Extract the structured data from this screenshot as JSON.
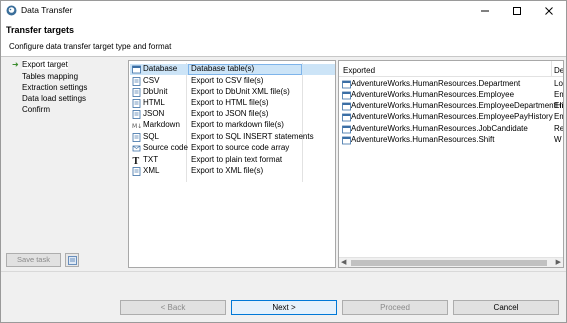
{
  "window": {
    "title": "Data Transfer",
    "controls": {
      "minimize": "minimize-icon",
      "maximize": "maximize-icon",
      "close": "close-icon"
    }
  },
  "header": {
    "title": "Transfer targets",
    "subtitle": "Configure data transfer target type and format"
  },
  "nav": {
    "items": [
      {
        "label": "Export target",
        "active": true
      },
      {
        "label": "Tables mapping",
        "active": false
      },
      {
        "label": "Extraction settings",
        "active": false
      },
      {
        "label": "Data load settings",
        "active": false
      },
      {
        "label": "Confirm",
        "active": false
      }
    ],
    "save_task_label": "Save task"
  },
  "targets": [
    {
      "name": "Database",
      "desc": "Database table(s)",
      "icon": "database-icon",
      "selected": true
    },
    {
      "name": "CSV",
      "desc": "Export to CSV file(s)",
      "icon": "csv-icon",
      "selected": false
    },
    {
      "name": "DbUnit",
      "desc": "Export to DbUnit XML file(s)",
      "icon": "dbunit-icon",
      "selected": false
    },
    {
      "name": "HTML",
      "desc": "Export to HTML file(s)",
      "icon": "html-icon",
      "selected": false
    },
    {
      "name": "JSON",
      "desc": "Export to JSON file(s)",
      "icon": "json-icon",
      "selected": false
    },
    {
      "name": "Markdown",
      "desc": "Export to markdown file(s)",
      "icon": "markdown-icon",
      "selected": false
    },
    {
      "name": "SQL",
      "desc": "Export to SQL INSERT statements",
      "icon": "sql-icon",
      "selected": false
    },
    {
      "name": "Source code",
      "desc": "Export to source code array",
      "icon": "source-code-icon",
      "selected": false
    },
    {
      "name": "TXT",
      "desc": "Export to plain text format",
      "icon": "txt-icon",
      "selected": false
    },
    {
      "name": "XML",
      "desc": "Export to XML file(s)",
      "icon": "xml-icon",
      "selected": false
    }
  ],
  "tables": {
    "columns": {
      "exported": "Exported",
      "description": "De"
    },
    "rows": [
      {
        "name": "AdventureWorks.HumanResources.Department",
        "desc": "Lo"
      },
      {
        "name": "AdventureWorks.HumanResources.Employee",
        "desc": "Em"
      },
      {
        "name": "AdventureWorks.HumanResources.EmployeeDepartmentHistory",
        "desc": "Em"
      },
      {
        "name": "AdventureWorks.HumanResources.EmployeePayHistory",
        "desc": "Em"
      },
      {
        "name": "AdventureWorks.HumanResources.JobCandidate",
        "desc": "Re"
      },
      {
        "name": "AdventureWorks.HumanResources.Shift",
        "desc": "W"
      }
    ]
  },
  "buttons": {
    "back": "< Back",
    "next": "Next >",
    "proceed": "Proceed",
    "cancel": "Cancel"
  },
  "colors": {
    "accent": "#0078d7",
    "selection": "#cce4f7",
    "nav_arrow": "#3c8d2f"
  }
}
